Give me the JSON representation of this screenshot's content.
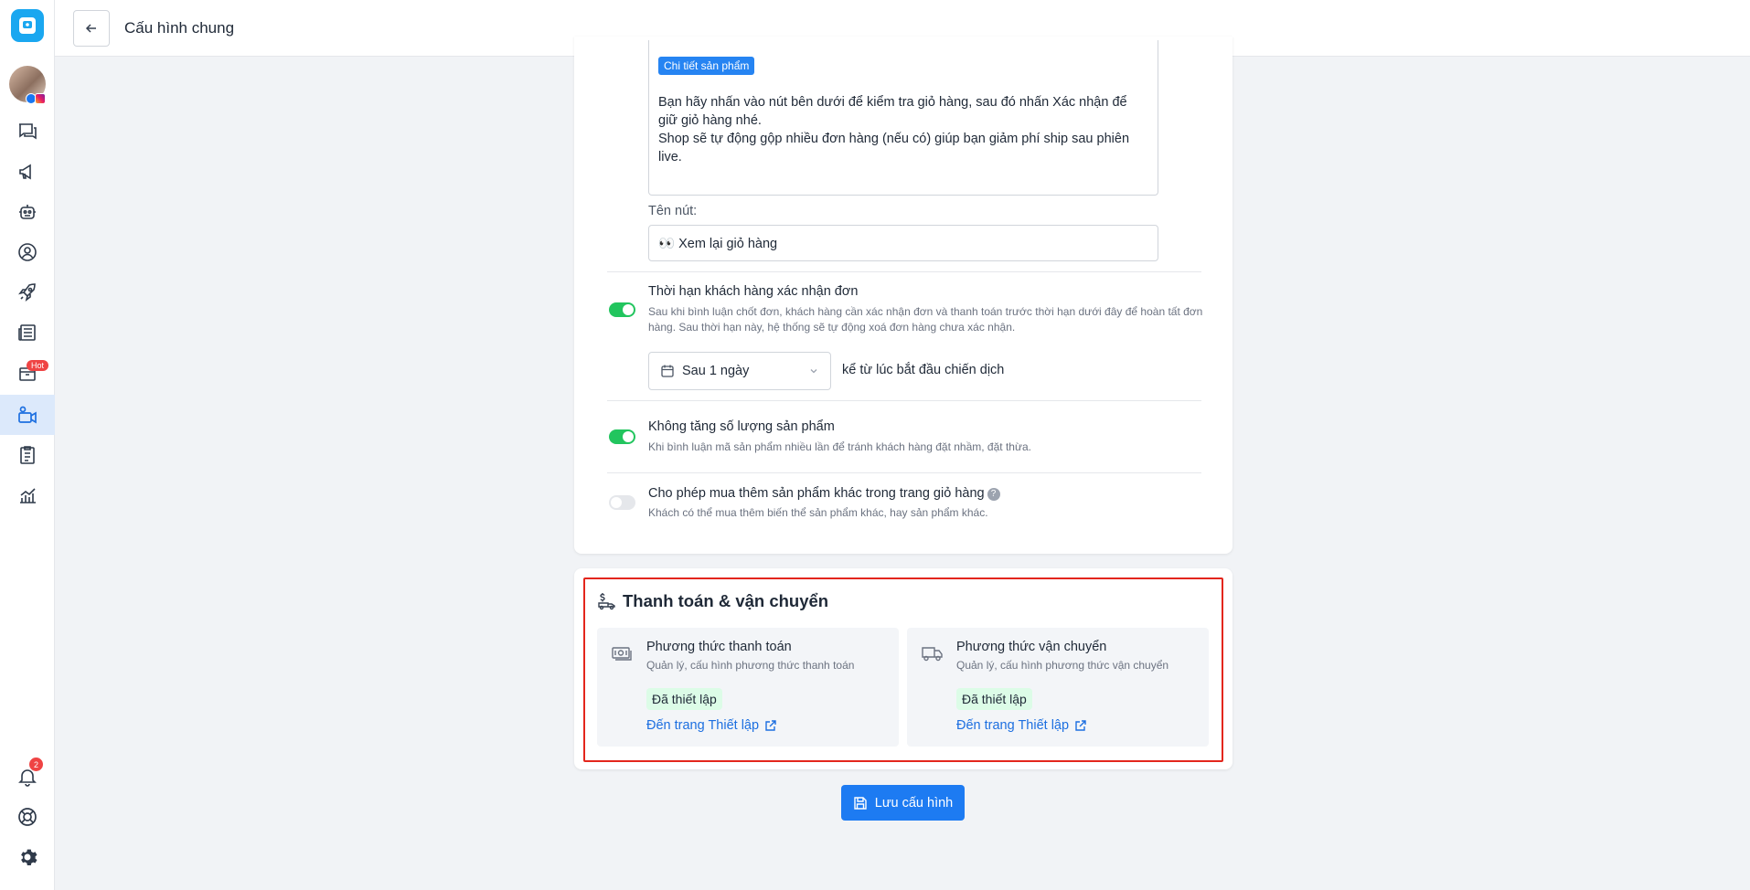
{
  "header": {
    "title": "Cấu hình chung"
  },
  "sidebar": {
    "hot_badge": "Hot",
    "notification_count": "2"
  },
  "message_editor": {
    "tag": "Chi tiết sản phẩm",
    "line1": "Bạn hãy nhấn vào nút bên dưới để kiểm tra giỏ hàng, sau đó nhấn Xác nhận để giữ giỏ hàng nhé.",
    "line2": "Shop sẽ tự động gộp nhiều đơn hàng (nếu có) giúp bạn giảm phí ship sau phiên live.",
    "button_label": "Tên nút:",
    "button_value": "👀 Xem lại giỏ hàng"
  },
  "options": {
    "deadline": {
      "title": "Thời hạn khách hàng xác nhận đơn",
      "desc": "Sau khi bình luận chốt đơn, khách hàng cần xác nhận đơn và thanh toán trước thời hạn dưới đây để hoàn tất đơn hàng. Sau thời hạn này, hệ thống sẽ tự động xoá đơn hàng chưa xác nhận.",
      "enabled": true,
      "select_value": "Sau 1 ngày",
      "select_suffix": "kể từ lúc bắt đầu chiến dịch"
    },
    "no_increase": {
      "title": "Không tăng số lượng sản phẩm",
      "desc": "Khi bình luận mã sản phẩm nhiều lần để tránh khách hàng đặt nhầm, đặt thừa.",
      "enabled": true
    },
    "allow_more": {
      "title": "Cho phép mua thêm sản phẩm khác trong trang giỏ hàng",
      "desc": "Khách có thể mua thêm biến thể sản phẩm khác, hay sản phẩm khác.",
      "enabled": false,
      "help": "?"
    }
  },
  "payment_shipping": {
    "title": "Thanh toán & vận chuyển",
    "payment": {
      "title": "Phương thức thanh toán",
      "desc": "Quản lý, cấu hình phương thức thanh toán",
      "status": "Đã thiết lập",
      "link": "Đến trang Thiết lập"
    },
    "shipping": {
      "title": "Phương thức vận chuyển",
      "desc": "Quản lý, cấu hình phương thức vận chuyển",
      "status": "Đã thiết lập",
      "link": "Đến trang Thiết lập"
    }
  },
  "save_button": "Lưu cấu hình",
  "colors": {
    "primary": "#1d7bf2",
    "toggle_on": "#22c55e",
    "highlight": "#e3261c",
    "status_bg": "#dcfce7"
  }
}
